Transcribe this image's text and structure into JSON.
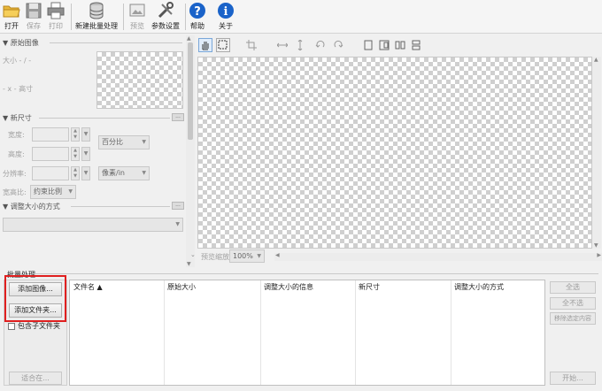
{
  "toolbar": {
    "open": "打开",
    "save": "保存",
    "print": "打印",
    "new_batch": "新建批量处理",
    "preview": "预览",
    "settings": "参数设置",
    "help": "帮助",
    "about": "关于"
  },
  "left_panel": {
    "original_image_header": "▼ 原始图像",
    "size_label": "大小 - / -",
    "dim_label": "- x - 高寸",
    "new_size_header": "▼ 新尺寸",
    "width_label": "宽度:",
    "height_label": "高度:",
    "resolution_label": "分辨率:",
    "unit_select": "百分比",
    "res_unit_select": "像素/in",
    "aspect_label": "宽高比:",
    "aspect_select": "约束比例",
    "resize_method_header": "▼ 调整大小的方式",
    "more_label": "..."
  },
  "preview": {
    "zoom_label": "预览缩放:",
    "zoom_value": "100%"
  },
  "batch": {
    "title": "批量处理",
    "add_image": "添加图像...",
    "add_folder": "添加文件夹...",
    "include_subfolders": "包含子文件夹",
    "fit": "适合在...",
    "columns": [
      "文件名 ▲",
      "原始大小",
      "调整大小的信息",
      "新尺寸",
      "调整大小的方式"
    ],
    "select_all": "全选",
    "select_none": "全不选",
    "remove_selected": "移除选定内容",
    "start": "开始..."
  },
  "colors": {
    "highlight": "#e02020",
    "active_tool": "#7aa7d9",
    "help_icon": "#1a63c9"
  }
}
